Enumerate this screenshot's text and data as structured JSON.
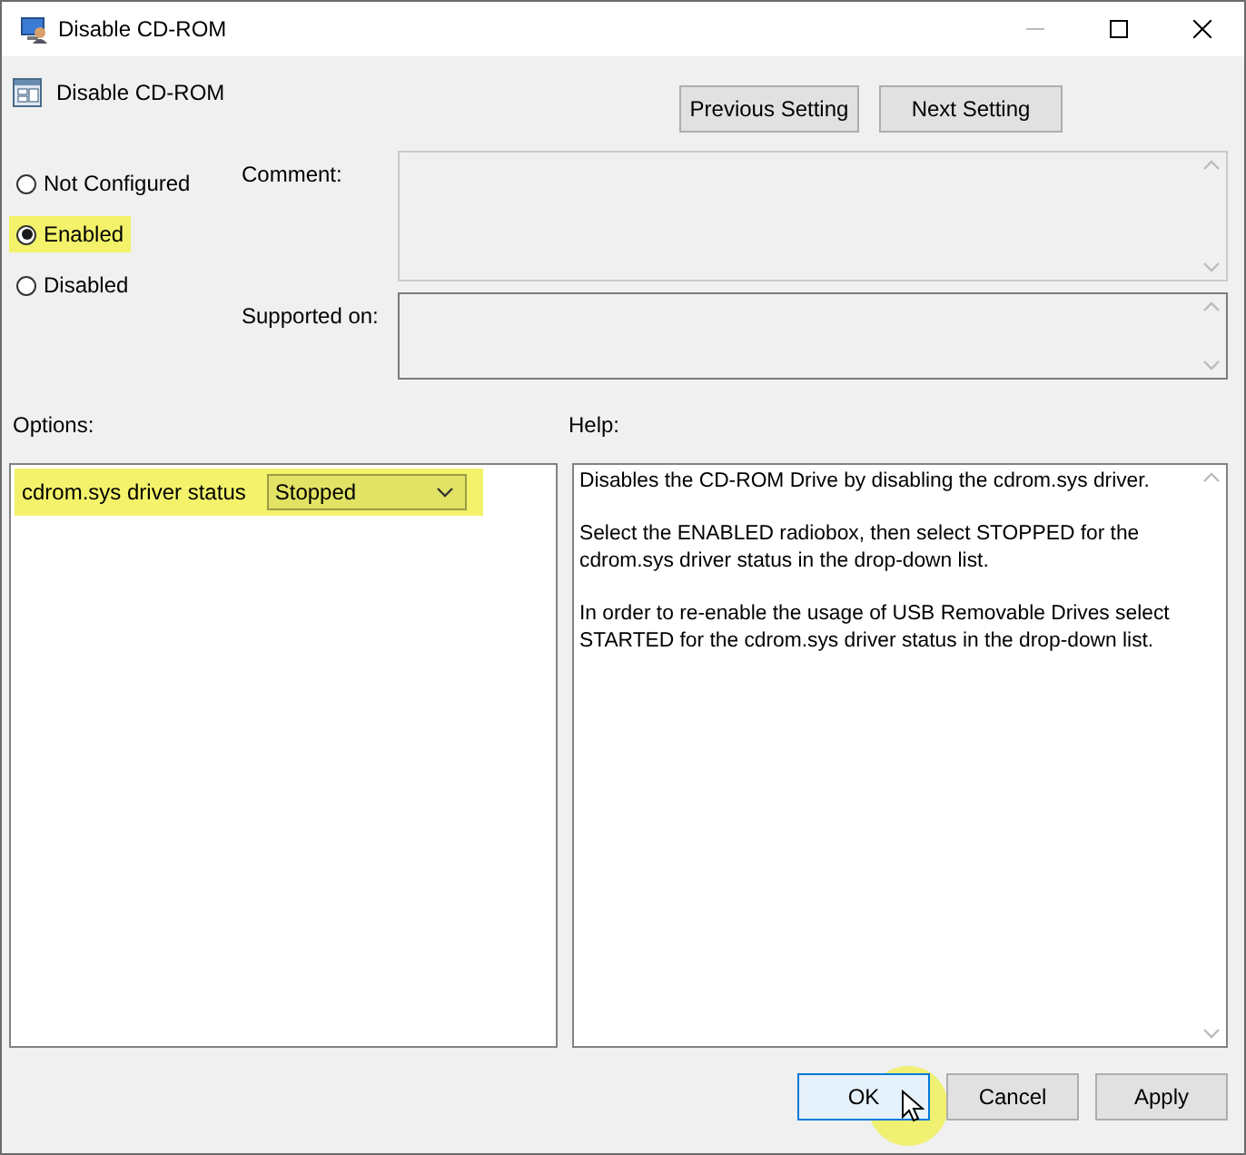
{
  "window": {
    "title": "Disable CD-ROM"
  },
  "policy_title": "Disable CD-ROM",
  "nav_buttons": [
    "Previous Setting",
    "Next Setting"
  ],
  "state_options": [
    {
      "label": "Not Configured",
      "selected": false,
      "highlighted": false
    },
    {
      "label": "Enabled",
      "selected": true,
      "highlighted": true
    },
    {
      "label": "Disabled",
      "selected": false,
      "highlighted": false
    }
  ],
  "comment": {
    "label": "Comment:"
  },
  "supported_on": {
    "label": "Supported on:"
  },
  "options": {
    "label": "Options:",
    "items": [
      {
        "label": "cdrom.sys driver status",
        "value": "Stopped",
        "highlighted": true
      }
    ]
  },
  "help": {
    "label": "Help:",
    "paragraphs": [
      "Disables the CD-ROM Drive by disabling the cdrom.sys driver.",
      "Select the ENABLED radiobox, then select STOPPED for the cdrom.sys driver status in the drop-down list.",
      "In order to re-enable the usage of USB Removable Drives select STARTED for the cdrom.sys driver status in the drop-down list."
    ]
  },
  "buttons": [
    {
      "label": "OK",
      "default": true,
      "highlighted": true
    },
    {
      "label": "Cancel",
      "default": false,
      "highlighted": false
    },
    {
      "label": "Apply",
      "default": false,
      "highlighted": false
    }
  ]
}
